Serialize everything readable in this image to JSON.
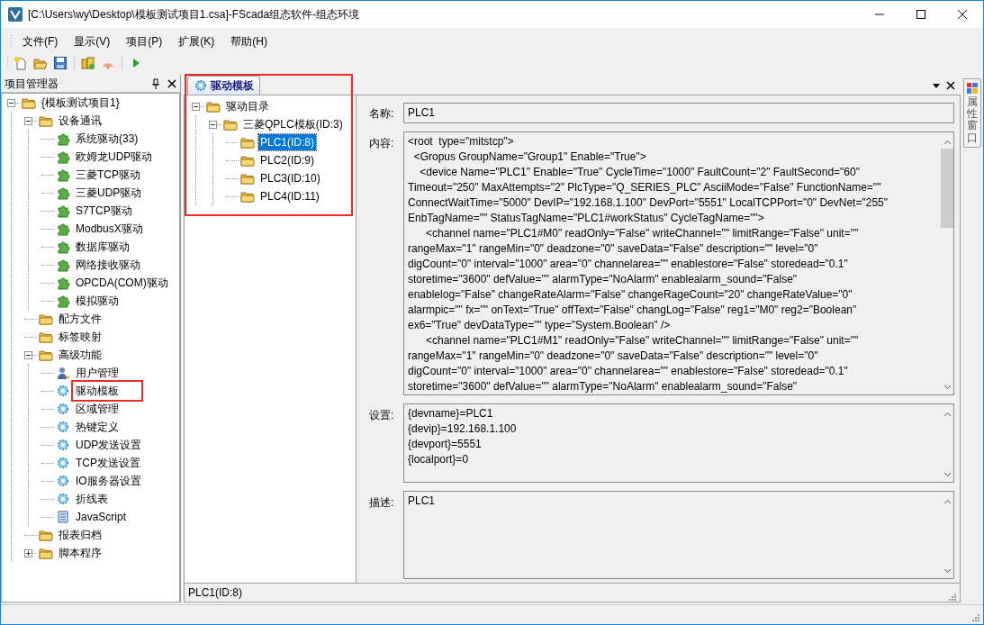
{
  "window": {
    "title": "[C:\\Users\\wy\\Desktop\\模板测试项目1.csa]-FScada组态软件-组态环境"
  },
  "menu": [
    "文件(F)",
    "显示(V)",
    "项目(P)",
    "扩展(K)",
    "帮助(H)"
  ],
  "toolbar": [
    {
      "kind": "new"
    },
    {
      "kind": "open"
    },
    {
      "kind": "save"
    },
    {
      "kind": "sep"
    },
    {
      "kind": "db"
    },
    {
      "kind": "signal"
    },
    {
      "kind": "sep"
    },
    {
      "kind": "run"
    }
  ],
  "project_panel": {
    "title": "项目管理器",
    "tree": [
      {
        "label": "{模板测试项目1}",
        "kind": "folder",
        "expanded": true,
        "highlighted": false,
        "children": [
          {
            "label": "设备通讯",
            "kind": "folder",
            "expanded": true,
            "highlighted": false,
            "children": [
              {
                "label": "系统驱动(33)",
                "kind": "puzzle",
                "highlighted": false
              },
              {
                "label": "欧姆龙UDP驱动",
                "kind": "puzzle",
                "highlighted": false
              },
              {
                "label": "三菱TCP驱动",
                "kind": "puzzle",
                "highlighted": false
              },
              {
                "label": "三菱UDP驱动",
                "kind": "puzzle",
                "highlighted": false
              },
              {
                "label": "S7TCP驱动",
                "kind": "puzzle",
                "highlighted": false
              },
              {
                "label": "ModbusX驱动",
                "kind": "puzzle",
                "highlighted": false
              },
              {
                "label": "数据库驱动",
                "kind": "puzzle",
                "highlighted": false
              },
              {
                "label": "网络接收驱动",
                "kind": "puzzle",
                "highlighted": false
              },
              {
                "label": "OPCDA(COM)驱动",
                "kind": "puzzle",
                "highlighted": false
              },
              {
                "label": "模拟驱动",
                "kind": "puzzle",
                "highlighted": false
              }
            ]
          },
          {
            "label": "配方文件",
            "kind": "folder",
            "highlighted": false
          },
          {
            "label": "标签映射",
            "kind": "folder",
            "highlighted": false
          },
          {
            "label": "高级功能",
            "kind": "folder",
            "expanded": true,
            "highlighted": false,
            "children": [
              {
                "label": "用户管理",
                "kind": "user",
                "highlighted": false
              },
              {
                "label": "驱动模板",
                "kind": "gear",
                "highlighted": true
              },
              {
                "label": "区域管理",
                "kind": "gear",
                "highlighted": false
              },
              {
                "label": "热键定义",
                "kind": "gear",
                "highlighted": false
              },
              {
                "label": "UDP发送设置",
                "kind": "gear",
                "highlighted": false
              },
              {
                "label": "TCP发送设置",
                "kind": "gear",
                "highlighted": false
              },
              {
                "label": "IO服务器设置",
                "kind": "gear",
                "highlighted": false
              },
              {
                "label": "折线表",
                "kind": "gear",
                "highlighted": false
              },
              {
                "label": "JavaScript",
                "kind": "script",
                "highlighted": false
              }
            ]
          },
          {
            "label": "报表归档",
            "kind": "folder",
            "highlighted": false
          },
          {
            "label": "脚本程序",
            "kind": "folder",
            "expanded": false,
            "highlighted": false
          }
        ]
      }
    ]
  },
  "document_tab": {
    "label": "驱动模板",
    "selected": true
  },
  "template_tree": {
    "outlined": true,
    "items": [
      {
        "label": "驱动目录",
        "expanded": true,
        "selected": false,
        "children": [
          {
            "label": "三菱QPLC模板(ID:3)",
            "expanded": true,
            "selected": false,
            "children": [
              {
                "label": "PLC1(ID:8)",
                "selected": true
              },
              {
                "label": "PLC2(ID:9)",
                "selected": false
              },
              {
                "label": "PLC3(ID:10)",
                "selected": false
              },
              {
                "label": "PLC4(ID:11)",
                "selected": false
              }
            ]
          }
        ]
      }
    ]
  },
  "form": {
    "name_label": "名称:",
    "name_value": "PLC1",
    "content_label": "内容:",
    "content_lines": [
      "<root  type=\"mitstcp\">",
      "  <Gropus GroupName=\"Group1\" Enable=\"True\">",
      "    <device Name=\"PLC1\" Enable=\"True\" CycleTime=\"1000\" FaultCount=\"2\" FaultSecond=\"60\"",
      "Timeout=\"250\" MaxAttempts=\"2\" PlcType=\"Q_SERIES_PLC\" AsciiMode=\"False\" FunctionName=\"\"",
      "ConnectWaitTime=\"5000\" DevIP=\"192.168.1.100\" DevPort=\"5551\" LocalTCPPort=\"0\" DevNet=\"255\"",
      "EnbTagName=\"\" StatusTagName=\"PLC1#workStatus\" CycleTagName=\"\">",
      "      <channel name=\"PLC1#M0\" readOnly=\"False\" writeChannel=\"\" limitRange=\"False\" unit=\"\"",
      "rangeMax=\"1\" rangeMin=\"0\" deadzone=\"0\" saveData=\"False\" description=\"\" level=\"0\"",
      "digCount=\"0\" interval=\"1000\" area=\"0\" channelarea=\"\" enablestore=\"False\" storedead=\"0.1\"",
      "storetime=\"3600\" defValue=\"\" alarmType=\"NoAlarm\" enablealarm_sound=\"False\"",
      "enablelog=\"False\" changeRateAlarm=\"False\" changeRageCount=\"20\" changeRateValue=\"0\"",
      "alarmpic=\"\" fx=\"\" onText=\"True\" offText=\"False\" changLog=\"False\" reg1=\"M0\" reg2=\"Boolean\"",
      "ex6=\"True\" devDataType=\"\" type=\"System.Boolean\" />",
      "      <channel name=\"PLC1#M1\" readOnly=\"False\" writeChannel=\"\" limitRange=\"False\" unit=\"\"",
      "rangeMax=\"1\" rangeMin=\"0\" deadzone=\"0\" saveData=\"False\" description=\"\" level=\"0\"",
      "digCount=\"0\" interval=\"1000\" area=\"0\" channelarea=\"\" enablestore=\"False\" storedead=\"0.1\"",
      "storetime=\"3600\" defValue=\"\" alarmType=\"NoAlarm\" enablealarm_sound=\"False\""
    ],
    "settings_label": "设置:",
    "settings_lines": [
      "{devname}=PLC1",
      "{devip}=192.168.1.100",
      "{devport}=5551",
      "{localport}=0"
    ],
    "description_label": "描述:",
    "description_lines": [
      "PLC1"
    ]
  },
  "panel_status": "PLC1(ID:8)",
  "side_tab": {
    "label": "属性窗口"
  }
}
